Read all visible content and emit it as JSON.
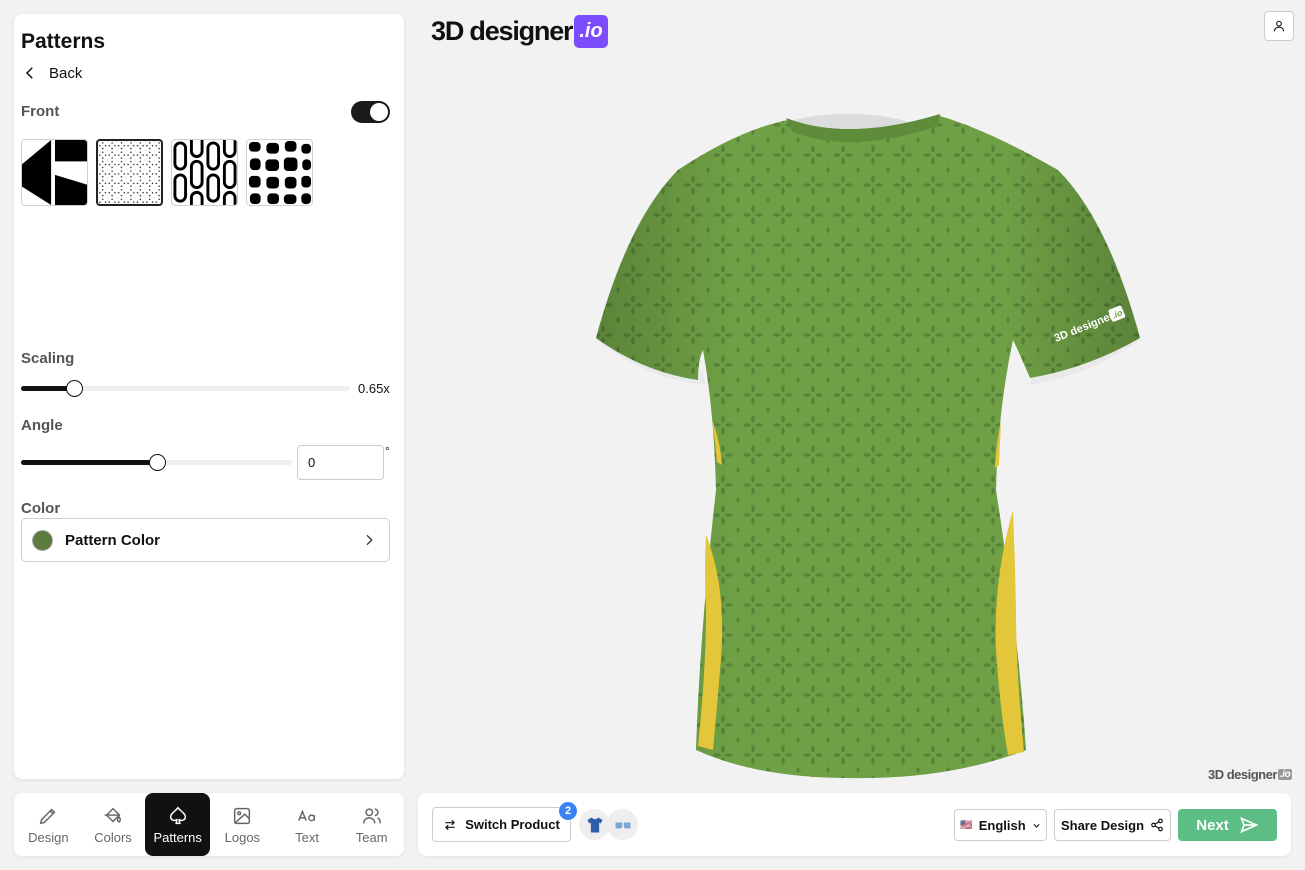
{
  "panel": {
    "title": "Patterns",
    "back_label": "Back",
    "front_label": "Front",
    "front_enabled": true,
    "patterns": [
      {
        "name": "chevron-blocks"
      },
      {
        "name": "dotted-star",
        "selected": true
      },
      {
        "name": "ovals"
      },
      {
        "name": "blobs"
      }
    ],
    "scaling_label": "Scaling",
    "scaling_value": "0.65x",
    "scaling_fraction": 0.16,
    "angle_label": "Angle",
    "angle_value": "0",
    "angle_unit": "°",
    "angle_fraction": 0.5,
    "color_label": "Color",
    "color_item_label": "Pattern Color",
    "pattern_color": "#5d7a3f"
  },
  "nav": {
    "items": [
      {
        "label": "Design",
        "icon": "pencil-icon"
      },
      {
        "label": "Colors",
        "icon": "paint-bucket-icon"
      },
      {
        "label": "Patterns",
        "icon": "spade-icon",
        "active": true
      },
      {
        "label": "Logos",
        "icon": "image-icon"
      },
      {
        "label": "Text",
        "icon": "text-icon"
      },
      {
        "label": "Team",
        "icon": "users-icon"
      }
    ]
  },
  "brand": {
    "text": "3D designer",
    "badge": ".io"
  },
  "watermark": {
    "text": "3D designer",
    "badge": ".io"
  },
  "shirt": {
    "logo_text": "3D designer",
    "logo_badge": ".io",
    "body_color": "#6fa045",
    "stripe_color": "#e3c63a"
  },
  "bottom_bar": {
    "switch_label": "Switch Product",
    "product_count": "2",
    "language": "English",
    "flag": "🇺🇸",
    "share_label": "Share Design",
    "next_label": "Next"
  }
}
